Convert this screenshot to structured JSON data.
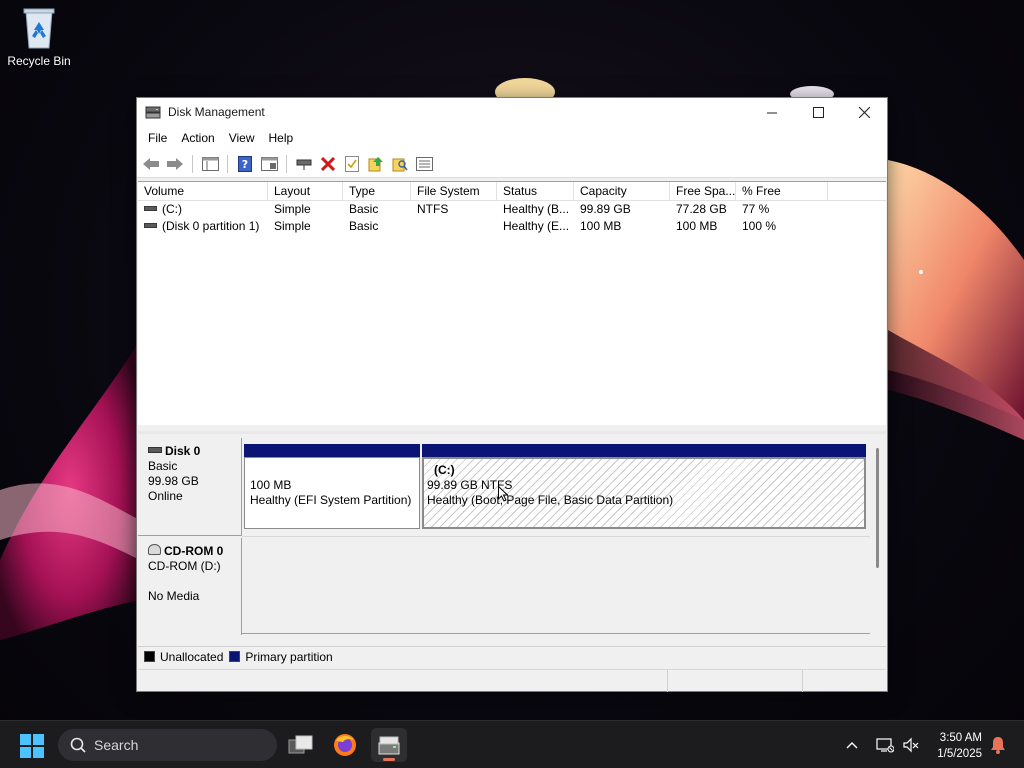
{
  "desktop": {
    "recycle_bin_label": "Recycle Bin"
  },
  "window": {
    "title": "Disk Management",
    "controls": {
      "minimize": "—",
      "maximize": "☐",
      "close": "✕"
    }
  },
  "menu": [
    "File",
    "Action",
    "View",
    "Help"
  ],
  "toolbar": {
    "buttons": [
      "back-icon",
      "forward-icon",
      "show-hide-console-tree-icon",
      "help-icon",
      "properties-icon",
      "connect-icon",
      "delete-icon",
      "check-icon",
      "export-icon",
      "search-icon",
      "list-view-icon"
    ]
  },
  "volume_list": {
    "columns": [
      "Volume",
      "Layout",
      "Type",
      "File System",
      "Status",
      "Capacity",
      "Free Spa...",
      "% Free"
    ],
    "rows": [
      [
        "(C:)",
        "Simple",
        "Basic",
        "NTFS",
        "Healthy (B...",
        "99.89 GB",
        "77.28 GB",
        "77 %"
      ],
      [
        "(Disk 0 partition 1)",
        "Simple",
        "Basic",
        "",
        "Healthy (E...",
        "100 MB",
        "100 MB",
        "100 %"
      ]
    ]
  },
  "disks": {
    "disk0": {
      "name": "Disk 0",
      "type": "Basic",
      "size": "99.98 GB",
      "status": "Online",
      "partitions": {
        "efi": {
          "size": "100 MB",
          "status": "Healthy (EFI System Partition)"
        },
        "c": {
          "label": "(C:)",
          "size_fs": "99.89 GB NTFS",
          "status": "Healthy (Boot, Page File, Basic Data Partition)"
        }
      }
    },
    "cdrom0": {
      "name": "CD-ROM 0",
      "drive": "CD-ROM (D:)",
      "media": "No Media"
    }
  },
  "legend": {
    "unallocated": "Unallocated",
    "primary": "Primary partition",
    "unallocated_color": "#000000",
    "primary_color": "#0a1474"
  },
  "taskbar": {
    "search_placeholder": "Search",
    "apps": [
      "task-view-icon",
      "firefox-icon",
      "disk-management-icon"
    ],
    "time": "3:50 AM",
    "date": "1/5/2025"
  }
}
